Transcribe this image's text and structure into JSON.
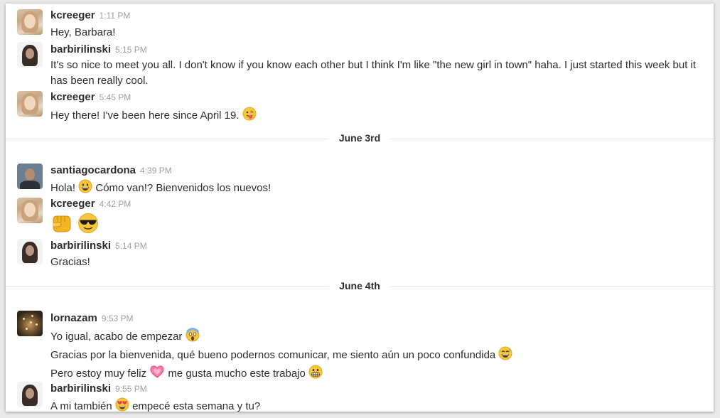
{
  "messages": [
    {
      "user": "kcreeger",
      "time": "1:11 PM",
      "lines": [
        "Hey, Barbara!"
      ]
    },
    {
      "user": "barbirilinski",
      "time": "5:15 PM",
      "lines": [
        "It's so nice to meet you all. I don't know if you know each other but I think I'm like \"the new girl in town\" haha. I just started this week but it has been really cool."
      ]
    },
    {
      "user": "kcreeger",
      "time": "5:45 PM",
      "lines": [
        "Hey there! I've been here since April 19."
      ]
    },
    {
      "user": "santiagocardona",
      "time": "4:39 PM",
      "lines": [
        "Hola!",
        "Cómo van!? Bienvenidos los nuevos!"
      ]
    },
    {
      "user": "kcreeger",
      "time": "4:42 PM",
      "lines": []
    },
    {
      "user": "barbirilinski",
      "time": "5:14 PM",
      "lines": [
        "Gracias!"
      ]
    },
    {
      "user": "lornazam",
      "time": "9:53 PM",
      "lines": [
        "Yo igual, acabo de empezar",
        "Gracias por la bienvenida, qué bueno podernos comunicar, me siento aún un poco confundida",
        "Pero estoy muy feliz",
        "me gusta mucho este trabajo"
      ]
    },
    {
      "user": "barbirilinski",
      "time": "9:55 PM",
      "lines": [
        "A mi también",
        "empecé esta semana y tu?"
      ]
    }
  ],
  "dividers": [
    "June 3rd",
    "June 4th"
  ],
  "icons": {
    "m2_emoji": "winking-face-with-tongue-icon",
    "m3_emoji": "grinning-face-icon",
    "m4_emoji_1": "oncoming-fist-icon",
    "m4_emoji_2": "smiling-face-with-sunglasses-icon",
    "m6_emoji_1": "face-screaming-in-fear-icon",
    "m6_emoji_2": "grinning-face-with-sweat-icon",
    "m6_emoji_3": "growing-heart-icon",
    "m6_emoji_4": "grimacing-face-icon",
    "m7_emoji": "smiling-face-with-heart-eyes-icon"
  },
  "colors": {
    "username": "#2c2d30",
    "timestamp": "#9e9ea6",
    "divider": "#e6e6e6"
  }
}
